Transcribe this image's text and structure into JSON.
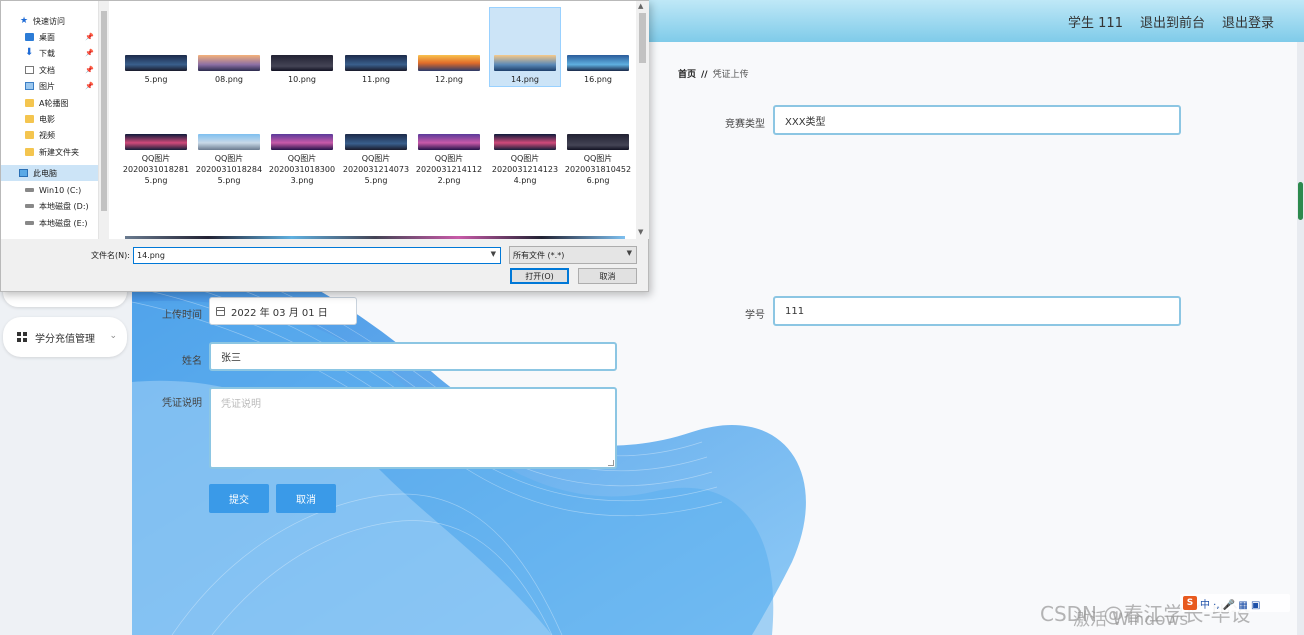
{
  "header": {
    "user_label": "学生 111",
    "back_label": "退出到前台",
    "logout_label": "退出登录"
  },
  "sidebar": {
    "menu_item": "学分充值管理"
  },
  "breadcrumb": {
    "home": "首页",
    "separator": "//",
    "current": "凭证上传"
  },
  "form": {
    "competition_type_label": "竞赛类型",
    "competition_type_value": "XXX类型",
    "upload_time_label": "上传时间",
    "upload_time_value": "2022 年 03 月 01 日",
    "student_no_label": "学号",
    "student_no_value": "111",
    "name_label": "姓名",
    "name_value": "张三",
    "note_label": "凭证说明",
    "note_placeholder": "凭证说明",
    "submit_label": "提交",
    "cancel_label": "取消"
  },
  "dialog": {
    "nav": [
      {
        "label": "快速访问",
        "icon": "star-icon"
      },
      {
        "label": "桌面",
        "icon": "desktop-icon",
        "pinned": true
      },
      {
        "label": "下载",
        "icon": "download-icon",
        "pinned": true
      },
      {
        "label": "文档",
        "icon": "document-icon",
        "pinned": true
      },
      {
        "label": "图片",
        "icon": "picture-icon",
        "pinned": true
      },
      {
        "label": "A轮播图",
        "icon": "folder-icon"
      },
      {
        "label": "电影",
        "icon": "folder-icon"
      },
      {
        "label": "视频",
        "icon": "folder-icon"
      },
      {
        "label": "新建文件夹",
        "icon": "folder-icon"
      },
      {
        "label": "此电脑",
        "icon": "computer-icon",
        "selected": true
      },
      {
        "label": "Win10 (C:)",
        "icon": "drive-icon"
      },
      {
        "label": "本地磁盘 (D:)",
        "icon": "drive-icon"
      },
      {
        "label": "本地磁盘 (E:)",
        "icon": "drive-icon"
      }
    ],
    "files_row1": [
      {
        "name": "5.png",
        "thumb": "t-night"
      },
      {
        "name": "08.png",
        "thumb": "t-dusk"
      },
      {
        "name": "10.png",
        "thumb": "t-dark"
      },
      {
        "name": "11.png",
        "thumb": "t-night"
      },
      {
        "name": "12.png",
        "thumb": "t-sunset"
      },
      {
        "name": "14.png",
        "thumb": "t-sea",
        "selected": true
      },
      {
        "name": "16.png",
        "thumb": "t-blue"
      }
    ],
    "files_row2": [
      {
        "name_lines": [
          "QQ图片",
          "2020031018281",
          "5.png"
        ],
        "thumb": "t-city"
      },
      {
        "name_lines": [
          "QQ图片",
          "2020031018284",
          "5.png"
        ],
        "thumb": "t-sky"
      },
      {
        "name_lines": [
          "QQ图片",
          "2020031018300",
          "3.png"
        ],
        "thumb": "t-purple"
      },
      {
        "name_lines": [
          "QQ图片",
          "2020031214073",
          "5.png"
        ],
        "thumb": "t-night"
      },
      {
        "name_lines": [
          "QQ图片",
          "2020031214112",
          "2.png"
        ],
        "thumb": "t-purple"
      },
      {
        "name_lines": [
          "QQ图片",
          "2020031214123",
          "4.png"
        ],
        "thumb": "t-city"
      },
      {
        "name_lines": [
          "QQ图片",
          "2020031810452",
          "6.png"
        ],
        "thumb": "t-dark"
      }
    ],
    "filename_label": "文件名(N):",
    "filename_value": "14.png",
    "filetype_value": "所有文件 (*.*)",
    "open_label": "打开(O)",
    "cancel_label": "取消"
  },
  "overlay": {
    "csdn_text": "CSDN @春江学长-毕设",
    "activate_text": "激活 Windows",
    "ime_text": "中 ·, 🎤 ▦ ▣"
  },
  "colors": {
    "primary": "#3a9ae8",
    "input_border": "#8cc6e3",
    "header_top": "#bfe8f7",
    "header_bottom": "#7fcbe9",
    "selection": "#cce4f7"
  }
}
